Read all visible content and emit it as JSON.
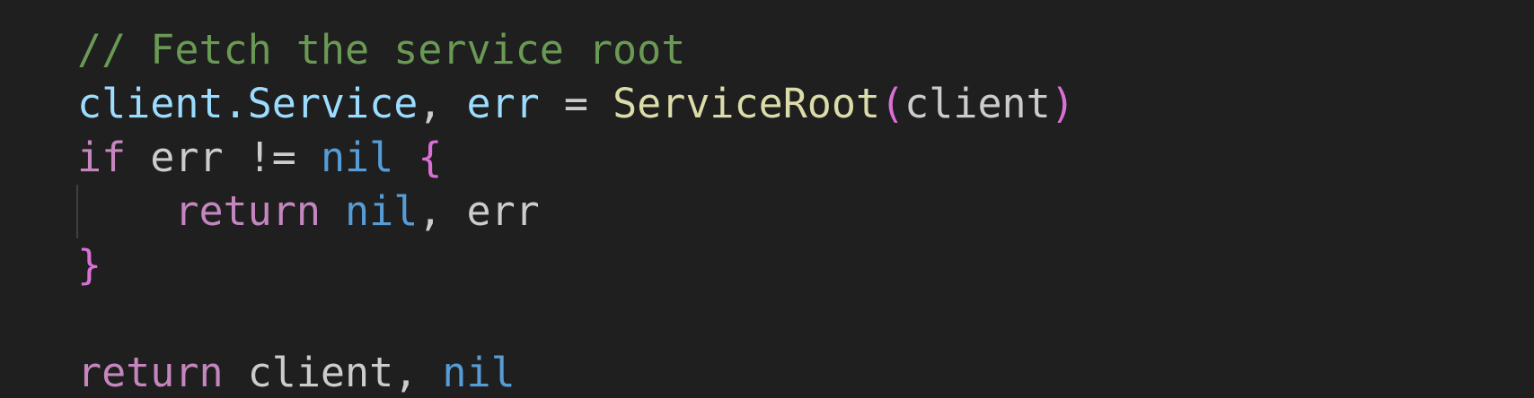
{
  "code": {
    "line1": {
      "comment": "// Fetch the service root"
    },
    "line2": {
      "client": "client",
      "dot": ".",
      "service": "Service",
      "comma1": ", ",
      "err": "err",
      "assign": " = ",
      "func": "ServiceRoot",
      "paren_open": "(",
      "arg": "client",
      "paren_close": ")"
    },
    "line3": {
      "kw_if": "if",
      "cond": " err != ",
      "nil": "nil",
      "space": " ",
      "brace_open": "{"
    },
    "line4": {
      "indent": "    ",
      "kw_return": "return",
      "space": " ",
      "nil": "nil",
      "rest": ", err"
    },
    "line5": {
      "brace_close": "}"
    },
    "line6": {
      "blank": ""
    },
    "line7": {
      "kw_return": "return",
      "rest": " client, ",
      "nil": "nil"
    }
  },
  "colors": {
    "background": "#1f1f1f",
    "comment": "#6a9955",
    "variable": "#9cdcfe",
    "function": "#dcdcaa",
    "keyword": "#c586c0",
    "constant": "#569cd6",
    "bracket": "#da70d6",
    "text": "#cccccc"
  }
}
